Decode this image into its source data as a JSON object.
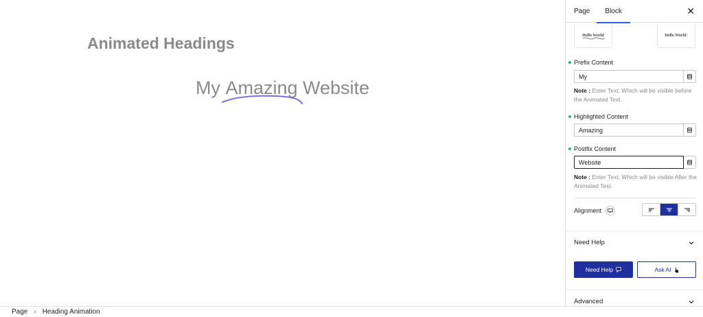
{
  "canvas": {
    "page_heading": "Animated Headings",
    "animated_heading": {
      "prefix": "My",
      "highlighted": "Amazing",
      "postfix": "Website",
      "underline_color": "#7b6ee6",
      "text_color": "#8a8a8a"
    }
  },
  "breadcrumb": {
    "items": [
      "Page",
      "Heading Animation"
    ],
    "separator": "›"
  },
  "sidebar": {
    "tabs": [
      {
        "label": "Page"
      },
      {
        "label": "Block"
      }
    ],
    "active_tab": "Block",
    "close_icon": "close-icon",
    "presets": [
      {
        "label": "Hello World"
      },
      {
        "label": "Hello World"
      }
    ],
    "prefix": {
      "label": "Prefix Content",
      "value": "My"
    },
    "prefix_note": {
      "label": "Note :",
      "text": " Enter Text, Which will be visible before the Animated Text."
    },
    "highlighted": {
      "label": "Highlighted Content",
      "value": "Amazing"
    },
    "postfix": {
      "label": "Postfix Content",
      "value": "Website"
    },
    "postfix_note": {
      "label": "Note :",
      "text": " Enter Text, Which will be visible After the Animated Text."
    },
    "alignment": {
      "label": "Alignment",
      "options": [
        "left",
        "center",
        "right"
      ],
      "selected": "center"
    },
    "need_help_panel": {
      "title": "Need Help",
      "need_help_button": "Need Help",
      "ask_ai_button": "Ask AI"
    },
    "advanced_panel": {
      "title": "Advanced"
    }
  },
  "colors": {
    "accent": "#1f2f9e",
    "tab_indicator": "#3858e9",
    "status_dot": "#2bb673"
  }
}
